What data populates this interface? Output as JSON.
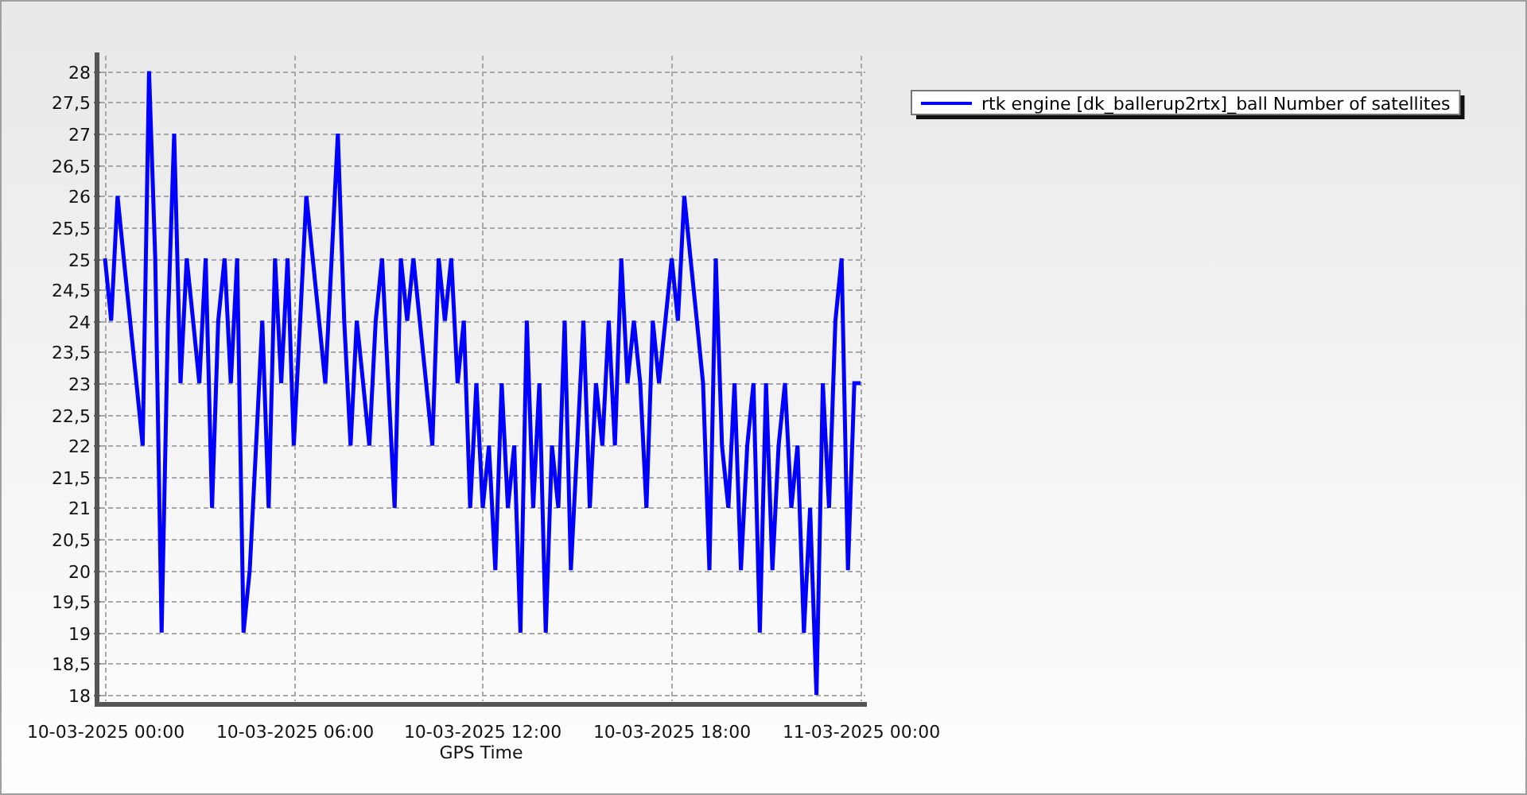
{
  "chart_data": {
    "type": "line",
    "xlabel": "GPS Time",
    "grid": true,
    "ylim": [
      17.9,
      28.2
    ],
    "yticks": [
      18,
      {
        "value": 18.5,
        "label": "18,5"
      },
      19,
      {
        "value": 19.5,
        "label": "19,5"
      },
      20,
      {
        "value": 20.5,
        "label": "20,5"
      },
      21,
      {
        "value": 21.5,
        "label": "21,5"
      },
      22,
      {
        "value": 22.5,
        "label": "22,5"
      },
      23,
      {
        "value": 23.5,
        "label": "23,5"
      },
      24,
      {
        "value": 24.5,
        "label": "24,5"
      },
      25,
      {
        "value": 25.5,
        "label": "25,5"
      },
      26,
      {
        "value": 26.5,
        "label": "26,5"
      },
      27,
      {
        "value": 27.5,
        "label": "27,5"
      },
      28
    ],
    "categories": [
      "10-03-2025 00:00",
      null,
      null,
      null,
      null,
      null,
      null,
      null,
      null,
      null,
      null,
      null,
      null,
      null,
      null,
      null,
      null,
      null,
      null,
      null,
      null,
      null,
      null,
      null,
      null,
      null,
      null,
      null,
      null,
      null,
      "10-03-2025 06:00",
      null,
      null,
      null,
      null,
      null,
      null,
      null,
      null,
      null,
      null,
      null,
      null,
      null,
      null,
      null,
      null,
      null,
      null,
      null,
      null,
      null,
      null,
      null,
      null,
      null,
      null,
      null,
      null,
      null,
      "10-03-2025 12:00",
      null,
      null,
      null,
      null,
      null,
      null,
      null,
      null,
      null,
      null,
      null,
      null,
      null,
      null,
      null,
      null,
      null,
      null,
      null,
      null,
      null,
      null,
      null,
      null,
      null,
      null,
      null,
      null,
      null,
      "10-03-2025 18:00",
      null,
      null,
      null,
      null,
      null,
      null,
      null,
      null,
      null,
      null,
      null,
      null,
      null,
      null,
      null,
      null,
      null,
      null,
      null,
      null,
      null,
      null,
      null,
      null,
      null,
      null,
      null,
      null,
      null,
      "11-03-2025 00:00"
    ],
    "series": [
      {
        "name": "rtk engine [dk_ballerup2rtx]_ball Number of satellites",
        "color": "#0000ff",
        "values": [
          25,
          24,
          26,
          25,
          24,
          23,
          22,
          28,
          25,
          19,
          24,
          27,
          23,
          25,
          24,
          23,
          25,
          21,
          24,
          25,
          23,
          25,
          19,
          20,
          22,
          24,
          21,
          25,
          23,
          25,
          22,
          24,
          26,
          25,
          24,
          23,
          25,
          27,
          24,
          22,
          24,
          23,
          22,
          24,
          25,
          23,
          21,
          25,
          24,
          25,
          24,
          23,
          22,
          25,
          24,
          25,
          23,
          24,
          21,
          23,
          21,
          22,
          20,
          23,
          21,
          22,
          19,
          24,
          21,
          23,
          19,
          22,
          21,
          24,
          20,
          22,
          24,
          21,
          23,
          22,
          24,
          22,
          25,
          23,
          24,
          23,
          21,
          24,
          23,
          24,
          25,
          24,
          26,
          25,
          24,
          23,
          20,
          25,
          22,
          21,
          23,
          20,
          22,
          23,
          19,
          23,
          20,
          22,
          23,
          21,
          22,
          19,
          21,
          18,
          23,
          21,
          24,
          25,
          20,
          23,
          23
        ]
      }
    ]
  }
}
